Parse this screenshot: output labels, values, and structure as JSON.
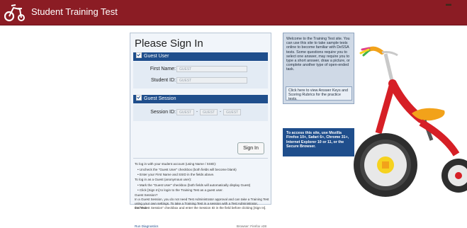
{
  "header": {
    "title": "Student Training Test",
    "logo_icon": "tricycle-logo-icon",
    "bg_color": "#8b1c24"
  },
  "signin": {
    "title": "Please Sign In",
    "guest_user": {
      "label": "Guest User",
      "first_name_label": "First Name:",
      "first_name_value": "GUEST",
      "student_id_label": "Student ID:",
      "student_id_value": "GUEST"
    },
    "guest_session": {
      "label": "Guest Session",
      "session_id_label": "Session ID:",
      "part1": "GUEST",
      "part2": "GUEST",
      "part3": "GUEST",
      "separator": "-"
    },
    "button_label": "Sign In",
    "info": {
      "intro": "To log in with your student account (using Name / SSID):",
      "bullet1": "Uncheck the \"Guest User\" checkbox (both fields will become blank)",
      "bullet2": "Enter your First Name and SSID in the fields above.",
      "guest_intro": "To log in as a Guest (anonymous user):",
      "bullet3": "Mark the \"Guest User\" checkbox (both fields will automatically display Guest)",
      "bullet4": "Click [Sign In] to login to the Training Test as a guest user.",
      "session_q": "Guest Session?",
      "session_p1": "In a Guest Session, you do not need Test Administrator approval and can take a Training Test",
      "session_p2": "using your own settings. To take a Training Test in a session with a Test Administrator, uncheck",
      "session_p3": "the \"Guest Session\" checkbox and enter the Session ID in the field before clicking [Sign In]."
    },
    "footer_link": "Run Diagnostics",
    "footer_browser": "Browser: Firefox v38"
  },
  "welcome": {
    "text": "Welcome to the Training Test site. You can use this site to take sample tests online to become familiar with DeSSA tests. Some questions require you to select one answer, may require you to type a short answer, draw a picture, or complete another type of open-ended task.",
    "box_text": "Click here to view Answer Keys and Scoring Rubrics for the practice tests."
  },
  "browser_note": {
    "text": "To access this site, use Mozilla Firefox 10+, Safari 6+, Chrome 31+, Internet Explorer 10 or 11, or the Secure Browser."
  }
}
